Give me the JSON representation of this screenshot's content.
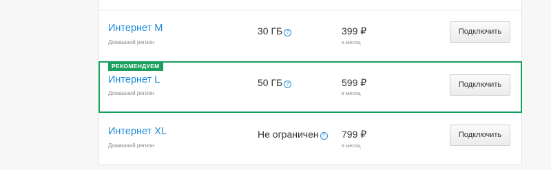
{
  "currency_symbol": "₽",
  "colors": {
    "accent_link": "#1b8bd9",
    "recommended_green": "#1aa05d"
  },
  "tariffs": [
    {
      "name": "Интернет M",
      "region": "Домашний регион",
      "volume": "30 ГБ",
      "price": "399 ₽",
      "period": "в месяц",
      "button": "Подключить"
    },
    {
      "badge": "РЕКОМЕНДУЕМ",
      "name": "Интернет L",
      "region": "Домашний регион",
      "volume": "50 ГБ",
      "price": "599 ₽",
      "period": "в месяц",
      "button": "Подключить"
    },
    {
      "name": "Интернет XL",
      "region": "Домашний регион",
      "volume": "Не ограничен",
      "price": "799 ₽",
      "period": "в месяц",
      "button": "Подключить"
    }
  ],
  "info_icon_glyph": "?"
}
